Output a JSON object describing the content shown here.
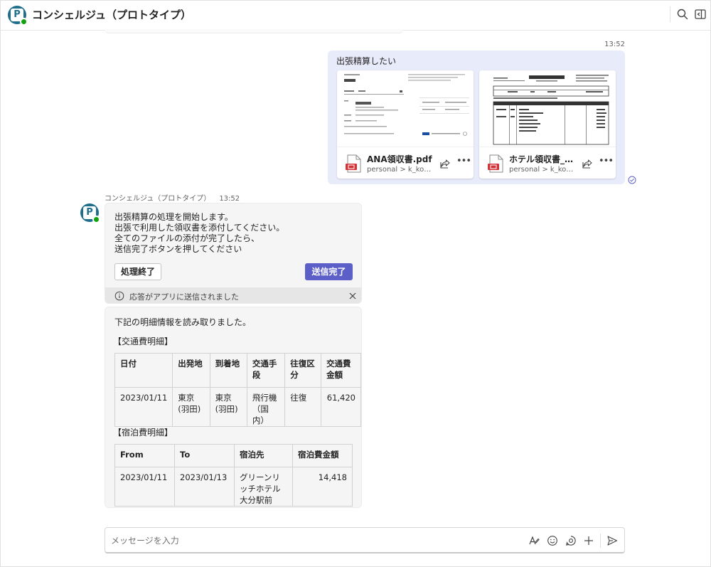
{
  "header": {
    "title": "コンシェルジュ（プロトタイプ）",
    "avatar_letter": "P",
    "icons": [
      "search-icon",
      "open-sidebar-icon"
    ]
  },
  "sent_message": {
    "time": "13:52",
    "text": "出張精算したい",
    "attachments": [
      {
        "name": "ANA領収書.pdf",
        "path": "personal > k_komu..."
      },
      {
        "name": "ホテル領収書_大...",
        "path": "personal > k_komu..."
      }
    ]
  },
  "bot_message": {
    "sender": "コンシェルジュ（プロトタイプ）",
    "time": "13:52",
    "card1": {
      "lines": [
        "出張精算の処理を開始します。",
        "出張で利用した領収書を添付してください。",
        "全てのファイルの添付が完了したら、",
        "送信完了ボタンを押してください"
      ],
      "button_end": "処理終了",
      "button_send": "送信完了",
      "notice": "応答がアプリに送信されました"
    },
    "card2": {
      "intro": "下記の明細情報を読み取りました。",
      "transport_title": "【交通費明細】",
      "transport_headers": [
        "日付",
        "出発地",
        "到着地",
        "交通手段",
        "往復区分",
        "交通費金額"
      ],
      "transport_rows": [
        [
          "2023/01/11",
          "東京(羽田)",
          "東京(羽田)",
          "飛行機（国内）",
          "往復",
          "61,420"
        ]
      ],
      "lodging_title": "【宿泊費明細】",
      "lodging_headers": [
        "From",
        "To",
        "宿泊先",
        "宿泊費金額"
      ],
      "lodging_rows": [
        [
          "2023/01/11",
          "2023/01/13",
          "グリーンリッチホテル大分駅前",
          "14,418"
        ]
      ]
    }
  },
  "compose": {
    "placeholder": "メッセージを入力"
  },
  "colors": {
    "accent": "#5b5fc7",
    "sent_bubble": "#e8ebfa",
    "bot_card": "#f5f5f5",
    "presence": "#13a10e",
    "app_icon": "#1f6f8b"
  }
}
